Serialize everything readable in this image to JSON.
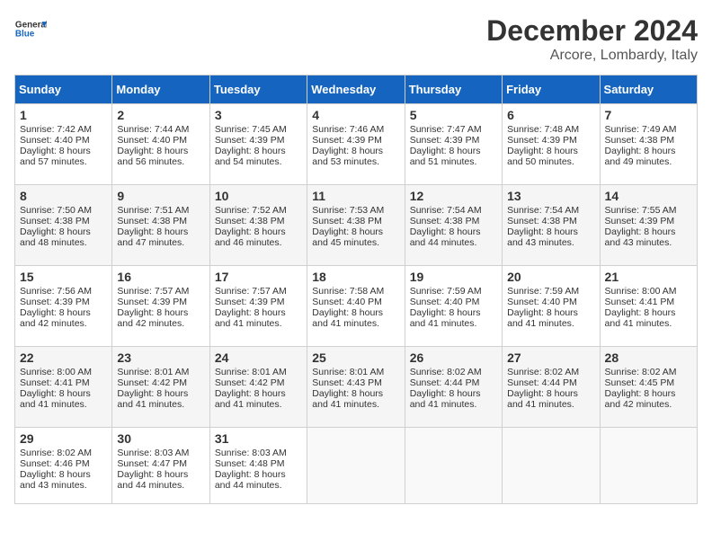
{
  "header": {
    "logo_general": "General",
    "logo_blue": "Blue",
    "month": "December 2024",
    "location": "Arcore, Lombardy, Italy"
  },
  "days_of_week": [
    "Sunday",
    "Monday",
    "Tuesday",
    "Wednesday",
    "Thursday",
    "Friday",
    "Saturday"
  ],
  "weeks": [
    [
      {
        "day": "1",
        "sunrise": "Sunrise: 7:42 AM",
        "sunset": "Sunset: 4:40 PM",
        "daylight": "Daylight: 8 hours and 57 minutes."
      },
      {
        "day": "2",
        "sunrise": "Sunrise: 7:44 AM",
        "sunset": "Sunset: 4:40 PM",
        "daylight": "Daylight: 8 hours and 56 minutes."
      },
      {
        "day": "3",
        "sunrise": "Sunrise: 7:45 AM",
        "sunset": "Sunset: 4:39 PM",
        "daylight": "Daylight: 8 hours and 54 minutes."
      },
      {
        "day": "4",
        "sunrise": "Sunrise: 7:46 AM",
        "sunset": "Sunset: 4:39 PM",
        "daylight": "Daylight: 8 hours and 53 minutes."
      },
      {
        "day": "5",
        "sunrise": "Sunrise: 7:47 AM",
        "sunset": "Sunset: 4:39 PM",
        "daylight": "Daylight: 8 hours and 51 minutes."
      },
      {
        "day": "6",
        "sunrise": "Sunrise: 7:48 AM",
        "sunset": "Sunset: 4:39 PM",
        "daylight": "Daylight: 8 hours and 50 minutes."
      },
      {
        "day": "7",
        "sunrise": "Sunrise: 7:49 AM",
        "sunset": "Sunset: 4:38 PM",
        "daylight": "Daylight: 8 hours and 49 minutes."
      }
    ],
    [
      {
        "day": "8",
        "sunrise": "Sunrise: 7:50 AM",
        "sunset": "Sunset: 4:38 PM",
        "daylight": "Daylight: 8 hours and 48 minutes."
      },
      {
        "day": "9",
        "sunrise": "Sunrise: 7:51 AM",
        "sunset": "Sunset: 4:38 PM",
        "daylight": "Daylight: 8 hours and 47 minutes."
      },
      {
        "day": "10",
        "sunrise": "Sunrise: 7:52 AM",
        "sunset": "Sunset: 4:38 PM",
        "daylight": "Daylight: 8 hours and 46 minutes."
      },
      {
        "day": "11",
        "sunrise": "Sunrise: 7:53 AM",
        "sunset": "Sunset: 4:38 PM",
        "daylight": "Daylight: 8 hours and 45 minutes."
      },
      {
        "day": "12",
        "sunrise": "Sunrise: 7:54 AM",
        "sunset": "Sunset: 4:38 PM",
        "daylight": "Daylight: 8 hours and 44 minutes."
      },
      {
        "day": "13",
        "sunrise": "Sunrise: 7:54 AM",
        "sunset": "Sunset: 4:38 PM",
        "daylight": "Daylight: 8 hours and 43 minutes."
      },
      {
        "day": "14",
        "sunrise": "Sunrise: 7:55 AM",
        "sunset": "Sunset: 4:39 PM",
        "daylight": "Daylight: 8 hours and 43 minutes."
      }
    ],
    [
      {
        "day": "15",
        "sunrise": "Sunrise: 7:56 AM",
        "sunset": "Sunset: 4:39 PM",
        "daylight": "Daylight: 8 hours and 42 minutes."
      },
      {
        "day": "16",
        "sunrise": "Sunrise: 7:57 AM",
        "sunset": "Sunset: 4:39 PM",
        "daylight": "Daylight: 8 hours and 42 minutes."
      },
      {
        "day": "17",
        "sunrise": "Sunrise: 7:57 AM",
        "sunset": "Sunset: 4:39 PM",
        "daylight": "Daylight: 8 hours and 41 minutes."
      },
      {
        "day": "18",
        "sunrise": "Sunrise: 7:58 AM",
        "sunset": "Sunset: 4:40 PM",
        "daylight": "Daylight: 8 hours and 41 minutes."
      },
      {
        "day": "19",
        "sunrise": "Sunrise: 7:59 AM",
        "sunset": "Sunset: 4:40 PM",
        "daylight": "Daylight: 8 hours and 41 minutes."
      },
      {
        "day": "20",
        "sunrise": "Sunrise: 7:59 AM",
        "sunset": "Sunset: 4:40 PM",
        "daylight": "Daylight: 8 hours and 41 minutes."
      },
      {
        "day": "21",
        "sunrise": "Sunrise: 8:00 AM",
        "sunset": "Sunset: 4:41 PM",
        "daylight": "Daylight: 8 hours and 41 minutes."
      }
    ],
    [
      {
        "day": "22",
        "sunrise": "Sunrise: 8:00 AM",
        "sunset": "Sunset: 4:41 PM",
        "daylight": "Daylight: 8 hours and 41 minutes."
      },
      {
        "day": "23",
        "sunrise": "Sunrise: 8:01 AM",
        "sunset": "Sunset: 4:42 PM",
        "daylight": "Daylight: 8 hours and 41 minutes."
      },
      {
        "day": "24",
        "sunrise": "Sunrise: 8:01 AM",
        "sunset": "Sunset: 4:42 PM",
        "daylight": "Daylight: 8 hours and 41 minutes."
      },
      {
        "day": "25",
        "sunrise": "Sunrise: 8:01 AM",
        "sunset": "Sunset: 4:43 PM",
        "daylight": "Daylight: 8 hours and 41 minutes."
      },
      {
        "day": "26",
        "sunrise": "Sunrise: 8:02 AM",
        "sunset": "Sunset: 4:44 PM",
        "daylight": "Daylight: 8 hours and 41 minutes."
      },
      {
        "day": "27",
        "sunrise": "Sunrise: 8:02 AM",
        "sunset": "Sunset: 4:44 PM",
        "daylight": "Daylight: 8 hours and 41 minutes."
      },
      {
        "day": "28",
        "sunrise": "Sunrise: 8:02 AM",
        "sunset": "Sunset: 4:45 PM",
        "daylight": "Daylight: 8 hours and 42 minutes."
      }
    ],
    [
      {
        "day": "29",
        "sunrise": "Sunrise: 8:02 AM",
        "sunset": "Sunset: 4:46 PM",
        "daylight": "Daylight: 8 hours and 43 minutes."
      },
      {
        "day": "30",
        "sunrise": "Sunrise: 8:03 AM",
        "sunset": "Sunset: 4:47 PM",
        "daylight": "Daylight: 8 hours and 44 minutes."
      },
      {
        "day": "31",
        "sunrise": "Sunrise: 8:03 AM",
        "sunset": "Sunset: 4:48 PM",
        "daylight": "Daylight: 8 hours and 44 minutes."
      },
      null,
      null,
      null,
      null
    ]
  ]
}
